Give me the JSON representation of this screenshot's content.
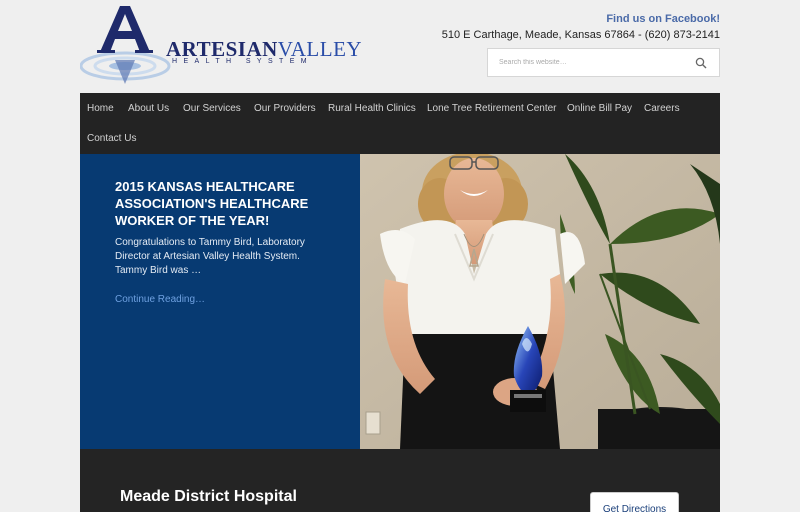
{
  "header": {
    "logo_word1": "ARTESIAN",
    "logo_word2": "VALLEY",
    "logo_subtitle": "HEALTH SYSTEM",
    "facebook_link": "Find us on Facebook!",
    "address": "510 E Carthage, Meade, Kansas 67864 - (620) 873-2141",
    "search_placeholder": "Search this website…"
  },
  "nav": {
    "items": [
      "Home",
      "About Us",
      "Our Services",
      "Our Providers",
      "Rural Health Clinics",
      "Lone Tree Retirement Center",
      "Online Bill Pay",
      "Careers",
      "Contact Us"
    ]
  },
  "hero": {
    "title": "2015 KANSAS HEALTHCARE ASSOCIATION'S HEALTHCARE WORKER OF THE YEAR!",
    "excerpt": "Congratulations to Tammy Bird, Laboratory Director at Artesian Valley Health System.  Tammy Bird was …",
    "link": "Continue Reading…"
  },
  "band": {
    "title": "Meade District Hospital",
    "button": "Get Directions"
  },
  "colors": {
    "nav_bg": "#232323",
    "hero_blue": "#073a72",
    "brand_navy": "#1f2a6b"
  }
}
